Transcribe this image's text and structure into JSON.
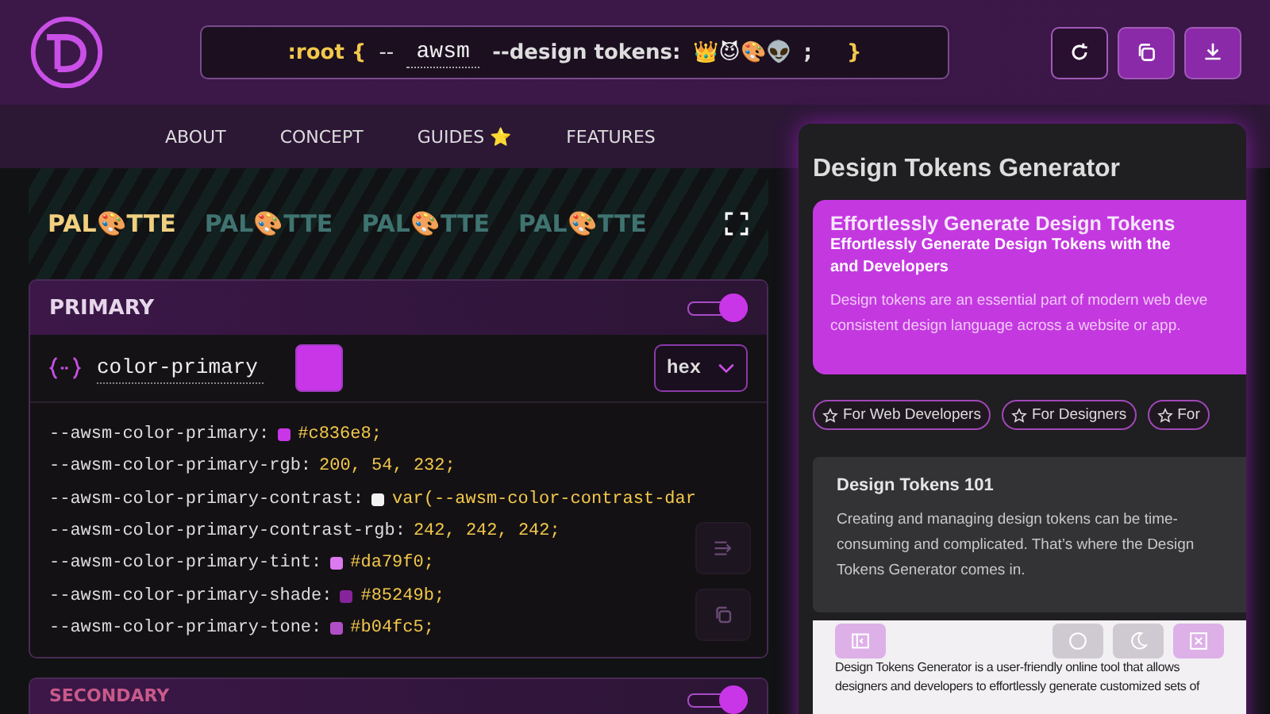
{
  "header": {
    "code_prefix": ":root {",
    "dashes": "--",
    "prefix_value": "awsm",
    "token_label": "--design tokens:",
    "emojis": "👑😈🎨👽",
    "semicolon": ";",
    "code_suffix": "}"
  },
  "nav": [
    {
      "label": "ABOUT"
    },
    {
      "label": "CONCEPT"
    },
    {
      "label": "GUIDES ⭐"
    },
    {
      "label": "FEATURES"
    }
  ],
  "palette": {
    "title": "PAL🎨TTE",
    "echo_titles": [
      "PAL🎨TTE",
      "PAL🎨TTE",
      "PAL🎨TTE"
    ]
  },
  "primary": {
    "title": "PRIMARY",
    "on": true,
    "name_value": "color-primary",
    "format": "hex",
    "lines": [
      {
        "name": "--awsm-color-primary:",
        "color": "#c836e8",
        "value": "#c836e8;"
      },
      {
        "name": "--awsm-color-primary-rgb:",
        "value": "200, 54, 232;"
      },
      {
        "name": "--awsm-color-primary-contrast:",
        "color": "#f2f2f2",
        "value": "var(--awsm-color-contrast-dar"
      },
      {
        "name": "--awsm-color-primary-contrast-rgb:",
        "value": "242, 242, 242;"
      },
      {
        "name": "--awsm-color-primary-tint:",
        "color": "#da79f0",
        "value": "#da79f0;"
      },
      {
        "name": "--awsm-color-primary-shade:",
        "color": "#85249b",
        "value": "#85249b;"
      },
      {
        "name": "--awsm-color-primary-tone:",
        "color": "#b04fc5",
        "value": "#b04fc5;"
      }
    ]
  },
  "secondary": {
    "title": "SECONDARY",
    "on": true
  },
  "panel": {
    "title": "Design Tokens Generator",
    "hero": {
      "heading": "Effortlessly Generate Design Tokens",
      "subheading_lines": [
        "Effortlessly Generate Design Tokens with the",
        "and Developers"
      ],
      "text_lines": [
        "Design tokens are an essential part of modern web deve",
        "consistent design language across a website or app."
      ]
    },
    "chips": [
      {
        "label": "For Web Developers"
      },
      {
        "label": "For Designers"
      },
      {
        "label": "For"
      }
    ],
    "card": {
      "title": "Design Tokens 101",
      "text": "Creating and managing design tokens can be time-consuming and complicated. That’s where the Design Tokens Generator comes in."
    },
    "preview_lines": [
      "Design Tokens Generator is a user-friendly online tool that allows",
      "designers and developers to effortlessly generate customized sets of"
    ]
  }
}
